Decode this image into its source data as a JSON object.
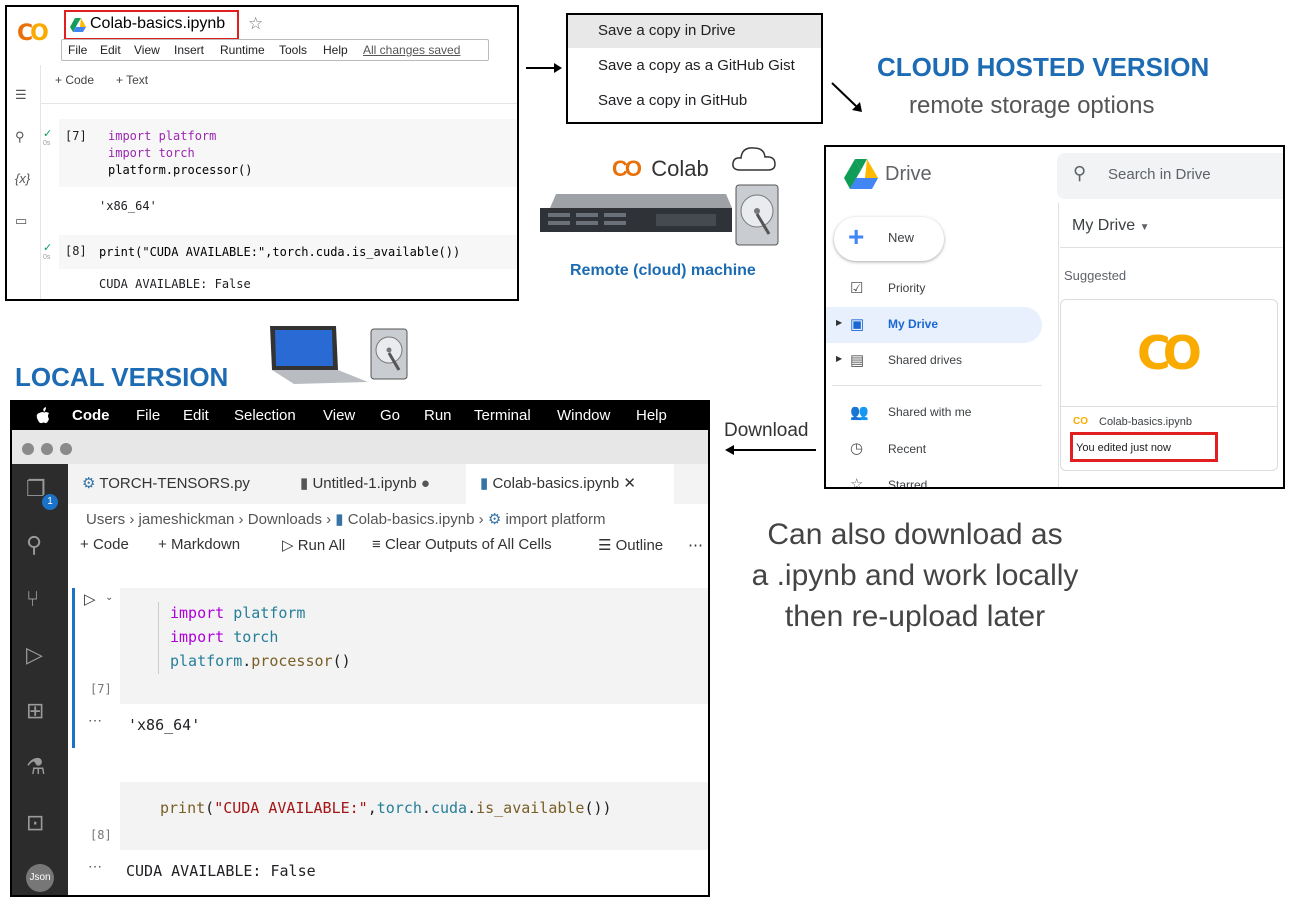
{
  "colab": {
    "file_name": "Colab-basics.ipynb",
    "menu": [
      "File",
      "Edit",
      "View",
      "Insert",
      "Runtime",
      "Tools",
      "Help"
    ],
    "saved_status": "All changes saved",
    "toolbar": {
      "code": "+ Code",
      "text": "+ Text"
    },
    "side_var": "{x}",
    "cells": [
      {
        "count": "[7]",
        "exec_time": "0s",
        "code": [
          "import platform",
          "import torch",
          "platform.processor()"
        ],
        "output": "'x86_64'"
      },
      {
        "count": "[8]",
        "exec_time": "0s",
        "code": [
          "print(\"CUDA AVAILABLE:\",torch.cuda.is_available())"
        ],
        "output": "CUDA AVAILABLE: False"
      }
    ]
  },
  "save_menu": [
    "Save a copy in Drive",
    "Save a copy as a GitHub Gist",
    "Save a copy in GitHub"
  ],
  "cloud_callout": {
    "title": "CLOUD HOSTED VERSION",
    "subtitle": "remote storage options"
  },
  "remote": {
    "brand": "Colab",
    "caption": "Remote (cloud) machine"
  },
  "local_callout": {
    "title": "LOCAL VERSION"
  },
  "drive": {
    "app_name": "Drive",
    "search_placeholder": "Search in Drive",
    "new_label": "New",
    "nav": [
      "Priority",
      "My Drive",
      "Shared drives",
      "Shared with me",
      "Recent",
      "Starred"
    ],
    "location": "My Drive",
    "suggested": "Suggested",
    "file_name": "Colab-basics.ipynb",
    "edited": "You edited just now"
  },
  "download_label": "Download",
  "note": [
    "Can also download as",
    "a .ipynb and work locally",
    "then re-upload later"
  ],
  "vscode": {
    "mac_menu": [
      "Code",
      "File",
      "Edit",
      "Selection",
      "View",
      "Go",
      "Run",
      "Terminal",
      "Window",
      "Help"
    ],
    "badge": "1",
    "tabs": [
      "TORCH-TENSORS.py",
      "Untitled-1.ipynb",
      "Colab-basics.ipynb"
    ],
    "breadcrumb": [
      "Users",
      "jameshickman",
      "Downloads",
      "Colab-basics.ipynb",
      "import platform"
    ],
    "toolbar": [
      "Code",
      "Markdown",
      "Run All",
      "Clear Outputs of All Cells",
      "Outline"
    ],
    "cells": [
      {
        "count": "[7]",
        "output": "'x86_64'"
      },
      {
        "count": "[8]",
        "output": "CUDA AVAILABLE: False"
      }
    ],
    "avatar": "Json"
  },
  "colors": {
    "callout": "#1d6cb3",
    "highlight": "#e02020",
    "drive_selected": "#e8f0fe"
  }
}
